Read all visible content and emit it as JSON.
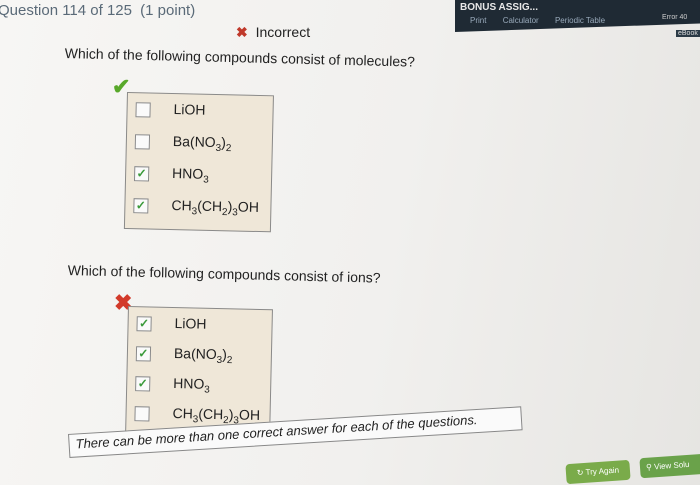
{
  "header": {
    "question_counter": "Question 114 of 125",
    "points": "(1 point)",
    "status": "Incorrect",
    "assignment_title": "BONUS ASSIG...",
    "tools": [
      "Print",
      "Calculator",
      "Periodic Table"
    ],
    "error_badge": "Error 40",
    "ebook": "eBook"
  },
  "questions": [
    {
      "prompt": "Which of the following compounds consist of molecules?",
      "result": "correct",
      "options": [
        {
          "checked": false
        },
        {
          "checked": false
        },
        {
          "checked": true
        },
        {
          "checked": true
        }
      ]
    },
    {
      "prompt": "Which of the following compounds consist of ions?",
      "result": "incorrect",
      "options": [
        {
          "checked": true
        },
        {
          "checked": true
        },
        {
          "checked": true
        },
        {
          "checked": false
        }
      ]
    }
  ],
  "footer": {
    "note": "There can be more than one correct answer for each of the questions.",
    "try_again": "Try Again",
    "view_solution": "View Solu"
  },
  "colors": {
    "correct": "#58a82a",
    "incorrect": "#d23a2a",
    "box_bg": "#efe7d8",
    "topbar": "#1f2a34"
  }
}
